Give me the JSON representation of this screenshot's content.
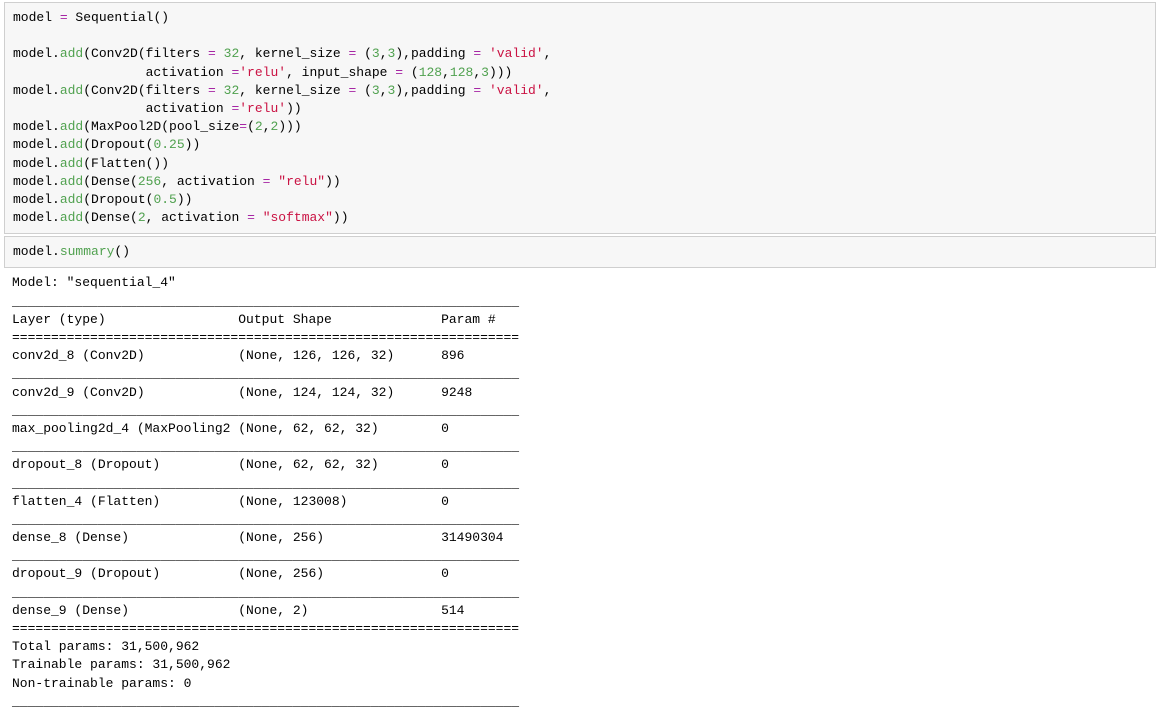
{
  "cell1": {
    "tokens": [
      [
        [
          "plain",
          "model "
        ],
        [
          "op",
          "="
        ],
        [
          "plain",
          " Sequential()"
        ]
      ],
      [
        [
          "plain",
          ""
        ]
      ],
      [
        [
          "plain",
          "model."
        ],
        [
          "green",
          "add"
        ],
        [
          "plain",
          "(Conv2D(filters "
        ],
        [
          "op",
          "="
        ],
        [
          "plain",
          " "
        ],
        [
          "num",
          "32"
        ],
        [
          "plain",
          ", kernel_size "
        ],
        [
          "op",
          "="
        ],
        [
          "plain",
          " ("
        ],
        [
          "num",
          "3"
        ],
        [
          "plain",
          ","
        ],
        [
          "num",
          "3"
        ],
        [
          "plain",
          "),padding "
        ],
        [
          "op",
          "="
        ],
        [
          "plain",
          " "
        ],
        [
          "str",
          "'valid'"
        ],
        [
          "plain",
          ","
        ]
      ],
      [
        [
          "plain",
          "                 activation "
        ],
        [
          "op",
          "="
        ],
        [
          "str",
          "'relu'"
        ],
        [
          "plain",
          ", input_shape "
        ],
        [
          "op",
          "="
        ],
        [
          "plain",
          " ("
        ],
        [
          "num",
          "128"
        ],
        [
          "plain",
          ","
        ],
        [
          "num",
          "128"
        ],
        [
          "plain",
          ","
        ],
        [
          "num",
          "3"
        ],
        [
          "plain",
          ")))"
        ]
      ],
      [
        [
          "plain",
          "model."
        ],
        [
          "green",
          "add"
        ],
        [
          "plain",
          "(Conv2D(filters "
        ],
        [
          "op",
          "="
        ],
        [
          "plain",
          " "
        ],
        [
          "num",
          "32"
        ],
        [
          "plain",
          ", kernel_size "
        ],
        [
          "op",
          "="
        ],
        [
          "plain",
          " ("
        ],
        [
          "num",
          "3"
        ],
        [
          "plain",
          ","
        ],
        [
          "num",
          "3"
        ],
        [
          "plain",
          "),padding "
        ],
        [
          "op",
          "="
        ],
        [
          "plain",
          " "
        ],
        [
          "str",
          "'valid'"
        ],
        [
          "plain",
          ","
        ]
      ],
      [
        [
          "plain",
          "                 activation "
        ],
        [
          "op",
          "="
        ],
        [
          "str",
          "'relu'"
        ],
        [
          "plain",
          "))"
        ]
      ],
      [
        [
          "plain",
          "model."
        ],
        [
          "green",
          "add"
        ],
        [
          "plain",
          "(MaxPool2D(pool_size"
        ],
        [
          "op",
          "="
        ],
        [
          "plain",
          "("
        ],
        [
          "num",
          "2"
        ],
        [
          "plain",
          ","
        ],
        [
          "num",
          "2"
        ],
        [
          "plain",
          ")))"
        ]
      ],
      [
        [
          "plain",
          "model."
        ],
        [
          "green",
          "add"
        ],
        [
          "plain",
          "(Dropout("
        ],
        [
          "num",
          "0.25"
        ],
        [
          "plain",
          "))"
        ]
      ],
      [
        [
          "plain",
          "model."
        ],
        [
          "green",
          "add"
        ],
        [
          "plain",
          "(Flatten())"
        ]
      ],
      [
        [
          "plain",
          "model."
        ],
        [
          "green",
          "add"
        ],
        [
          "plain",
          "(Dense("
        ],
        [
          "num",
          "256"
        ],
        [
          "plain",
          ", activation "
        ],
        [
          "op",
          "="
        ],
        [
          "plain",
          " "
        ],
        [
          "str",
          "\"relu\""
        ],
        [
          "plain",
          "))"
        ]
      ],
      [
        [
          "plain",
          "model."
        ],
        [
          "green",
          "add"
        ],
        [
          "plain",
          "(Dropout("
        ],
        [
          "num",
          "0.5"
        ],
        [
          "plain",
          "))"
        ]
      ],
      [
        [
          "plain",
          "model."
        ],
        [
          "green",
          "add"
        ],
        [
          "plain",
          "(Dense("
        ],
        [
          "num",
          "2"
        ],
        [
          "plain",
          ", activation "
        ],
        [
          "op",
          "="
        ],
        [
          "plain",
          " "
        ],
        [
          "str",
          "\"softmax\""
        ],
        [
          "plain",
          "))"
        ]
      ]
    ]
  },
  "cell2": {
    "tokens": [
      [
        [
          "plain",
          "model."
        ],
        [
          "green",
          "summary"
        ],
        [
          "plain",
          "()"
        ]
      ]
    ]
  },
  "output": {
    "model_line": "Model: \"sequential_4\"",
    "header": {
      "layer": "Layer (type)",
      "output": "Output Shape",
      "param": "Param #"
    },
    "rows": [
      {
        "layer": "conv2d_8 (Conv2D)",
        "output": "(None, 126, 126, 32)",
        "param": "896"
      },
      {
        "layer": "conv2d_9 (Conv2D)",
        "output": "(None, 124, 124, 32)",
        "param": "9248"
      },
      {
        "layer": "max_pooling2d_4 (MaxPooling2",
        "output": "(None, 62, 62, 32)",
        "param": "0"
      },
      {
        "layer": "dropout_8 (Dropout)",
        "output": "(None, 62, 62, 32)",
        "param": "0"
      },
      {
        "layer": "flatten_4 (Flatten)",
        "output": "(None, 123008)",
        "param": "0"
      },
      {
        "layer": "dense_8 (Dense)",
        "output": "(None, 256)",
        "param": "31490304"
      },
      {
        "layer": "dropout_9 (Dropout)",
        "output": "(None, 256)",
        "param": "0"
      },
      {
        "layer": "dense_9 (Dense)",
        "output": "(None, 2)",
        "param": "514"
      }
    ],
    "col_widths": {
      "layer": 29,
      "output": 26,
      "param": 10
    },
    "total_width": 65,
    "totals": [
      "Total params: 31,500,962",
      "Trainable params: 31,500,962",
      "Non-trainable params: 0"
    ]
  }
}
